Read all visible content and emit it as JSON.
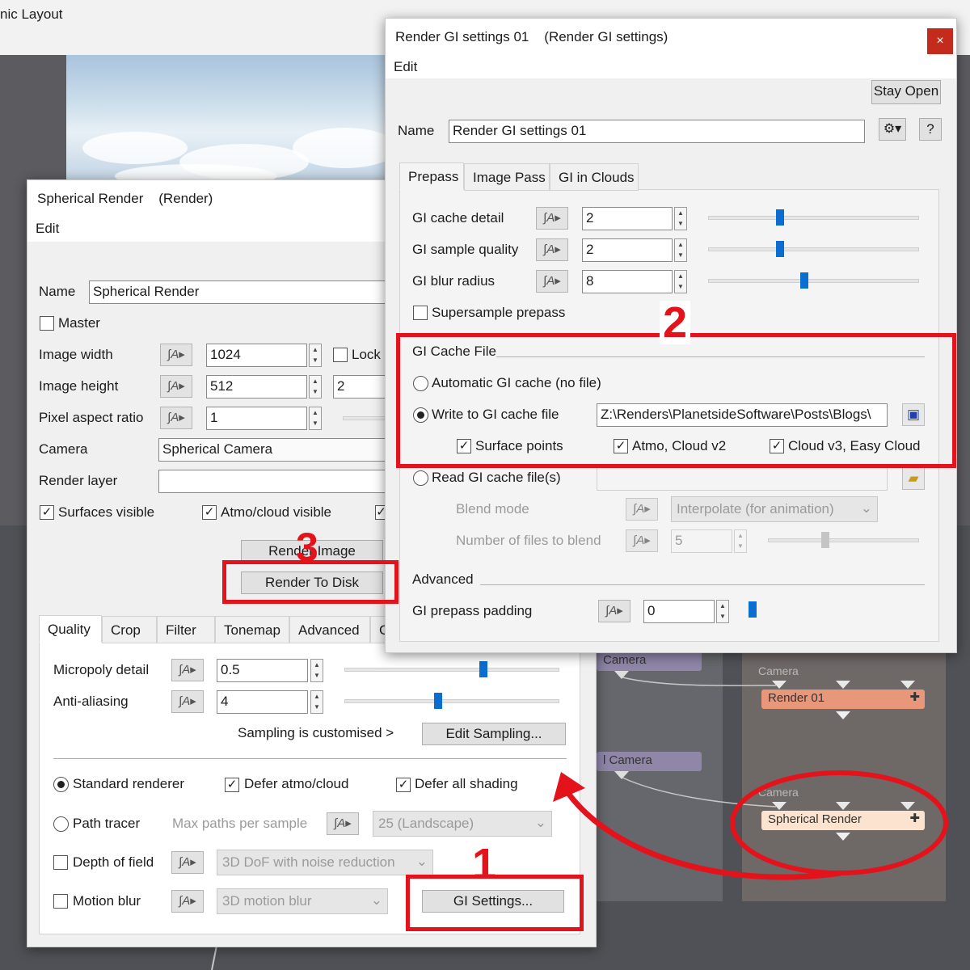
{
  "background": {
    "app_title": "nic Layout",
    "nodes": [
      {
        "label": "Camera"
      },
      {
        "label": "Camera"
      },
      {
        "label": "Render 01"
      },
      {
        "label": "l Camera"
      },
      {
        "label": "Camera"
      },
      {
        "label": "Spherical Render"
      }
    ]
  },
  "render_dialog": {
    "title": "Spherical Render",
    "type": "(Render)",
    "menu": "Edit",
    "name_label": "Name",
    "name_value": "Spherical Render",
    "master_label": "Master",
    "image_width_label": "Image width",
    "image_width_value": "1024",
    "lock_label": "Lock",
    "image_height_label": "Image height",
    "image_height_value": "512",
    "image_height_extra": "2",
    "pixel_aspect_label": "Pixel aspect ratio",
    "pixel_aspect_value": "1",
    "camera_label": "Camera",
    "camera_value": "Spherical Camera",
    "render_layer_label": "Render layer",
    "render_layer_value": "",
    "surfaces_visible": "Surfaces visible",
    "atmo_visible": "Atmo/cloud visible",
    "render_image_btn": "Render Image",
    "render_to_disk_btn": "Render To Disk",
    "tabs": [
      "Quality",
      "Crop",
      "Filter",
      "Tonemap",
      "Advanced",
      "C"
    ],
    "micropoly_label": "Micropoly detail",
    "micropoly_value": "0.5",
    "micropoly_level": 0.65,
    "antialias_label": "Anti-aliasing",
    "antialias_value": "4",
    "antialias_level": 0.43,
    "sampling_text": "Sampling is customised  >",
    "edit_sampling_btn": "Edit Sampling...",
    "standard_renderer": "Standard renderer",
    "defer_atmo": "Defer atmo/cloud",
    "defer_all": "Defer all shading",
    "path_tracer": "Path tracer",
    "max_paths_label": "Max paths per sample",
    "max_paths_value": "25 (Landscape)",
    "dof_label": "Depth of field",
    "dof_value": "3D DoF with noise reduction",
    "motion_blur_label": "Motion blur",
    "motion_blur_value": "3D motion blur",
    "gi_settings_btn": "GI Settings..."
  },
  "gi_dialog": {
    "title": "Render GI settings 01",
    "type": "(Render GI settings)",
    "menu": "Edit",
    "stay_open_btn": "Stay Open",
    "name_label": "Name",
    "name_value": "Render GI settings 01",
    "help_btn": "?",
    "tabs": [
      "Prepass",
      "Image Pass",
      "GI in Clouds"
    ],
    "cache_detail_label": "GI cache detail",
    "cache_detail_value": "2",
    "cache_detail_level": 0.33,
    "sample_quality_label": "GI sample quality",
    "sample_quality_value": "2",
    "sample_quality_level": 0.33,
    "blur_radius_label": "GI blur radius",
    "blur_radius_value": "8",
    "blur_radius_level": 0.45,
    "supersample_label": "Supersample prepass",
    "cache_file_group": "GI Cache File",
    "auto_cache_label": "Automatic GI cache (no file)",
    "write_cache_label": "Write to GI cache file",
    "write_cache_path": "Z:\\Renders\\PlanetsideSoftware\\Posts\\Blogs\\",
    "surface_points_label": "Surface points",
    "atmo_cloud_v2_label": "Atmo, Cloud v2",
    "cloud_v3_label": "Cloud v3, Easy Cloud",
    "read_cache_label": "Read GI cache file(s)",
    "blend_mode_label": "Blend mode",
    "blend_mode_value": "Interpolate (for animation)",
    "num_files_label": "Number of files to blend",
    "num_files_value": "5",
    "advanced_group": "Advanced",
    "prepass_padding_label": "GI prepass padding",
    "prepass_padding_value": "0",
    "prepass_padding_level": 0.0
  },
  "annotations": {
    "step1": "1",
    "step2": "2",
    "step3": "3",
    "accent_color": "#e4131b"
  }
}
